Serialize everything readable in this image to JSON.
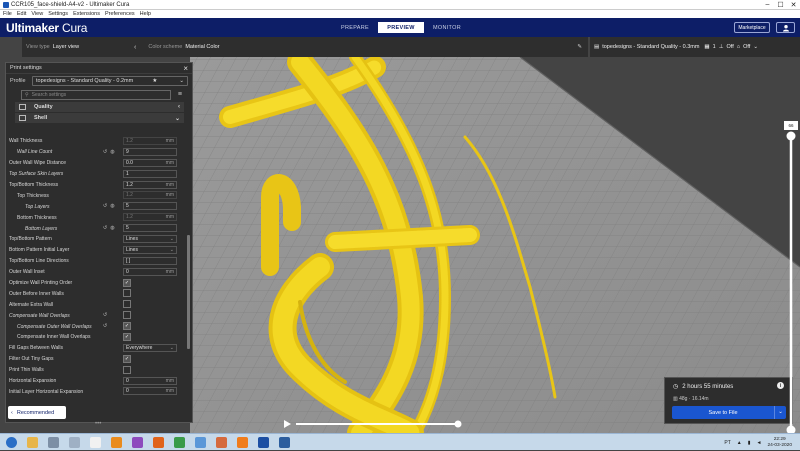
{
  "window": {
    "title": "CCR105_face-shield-A4-v2 - Ultimaker Cura",
    "controls": [
      "–",
      "☐",
      "✕"
    ]
  },
  "menu": [
    "File",
    "Edit",
    "View",
    "Settings",
    "Extensions",
    "Preferences",
    "Help"
  ],
  "header": {
    "logo_bold": "Ultimaker",
    "logo_light": " Cura",
    "stages": [
      {
        "label": "PREPARE",
        "active": false
      },
      {
        "label": "PREVIEW",
        "active": true
      },
      {
        "label": "MONITOR",
        "active": false
      }
    ],
    "marketplace_label": "Marketplace",
    "account_icon": "account-icon"
  },
  "view_bar": {
    "view_type_label": "View type",
    "view_type_value": "Layer view",
    "color_scheme_label": "Color scheme",
    "color_scheme_value": "Material Color",
    "chevron": "‹"
  },
  "print_bar": {
    "profile_text": "topedesigns - Standard Quality - 0.3mm",
    "percent": "1",
    "support_label": "Off",
    "adhesion_label": "Off"
  },
  "print_settings": {
    "title": "Print settings",
    "close": "×",
    "profile_label": "Profile",
    "profile_value": "topedesigns - Standard Quality - 0.2mm",
    "star": "★",
    "profile_chevron": "⌄",
    "search_placeholder": "Search settings",
    "menu_icon": "≡",
    "categories": [
      {
        "label": "Quality",
        "chevron": "‹"
      },
      {
        "label": "Shell",
        "chevron": "⌄"
      }
    ],
    "rows": [
      {
        "label": "Wall Thickness",
        "indent": 0,
        "italic": false,
        "type": "value",
        "value": "1.2",
        "unit": "mm",
        "disabled": true,
        "reset": false,
        "linked": false
      },
      {
        "label": "Wall Line Count",
        "indent": 1,
        "italic": true,
        "type": "value",
        "value": "9",
        "unit": "",
        "disabled": false,
        "reset": true,
        "linked": true
      },
      {
        "label": "Outer Wall Wipe Distance",
        "indent": 0,
        "italic": false,
        "type": "value",
        "value": "0.0",
        "unit": "mm",
        "disabled": false,
        "reset": false,
        "linked": false
      },
      {
        "label": "Top Surface Skin Layers",
        "indent": 0,
        "italic": true,
        "type": "value",
        "value": "1",
        "unit": "",
        "disabled": false,
        "reset": false,
        "linked": false
      },
      {
        "label": "Top/Bottom Thickness",
        "indent": 0,
        "italic": false,
        "type": "value",
        "value": "1.2",
        "unit": "mm",
        "disabled": false,
        "reset": false,
        "linked": false
      },
      {
        "label": "Top Thickness",
        "indent": 1,
        "italic": false,
        "type": "value",
        "value": "1.2",
        "unit": "mm",
        "disabled": true,
        "reset": false,
        "linked": false
      },
      {
        "label": "Top Layers",
        "indent": 2,
        "italic": true,
        "type": "value",
        "value": "5",
        "unit": "",
        "disabled": false,
        "reset": true,
        "linked": true
      },
      {
        "label": "Bottom Thickness",
        "indent": 1,
        "italic": false,
        "type": "value",
        "value": "1.2",
        "unit": "mm",
        "disabled": true,
        "reset": false,
        "linked": false
      },
      {
        "label": "Bottom Layers",
        "indent": 2,
        "italic": true,
        "type": "value",
        "value": "5",
        "unit": "",
        "disabled": false,
        "reset": true,
        "linked": true
      },
      {
        "label": "Top/Bottom Pattern",
        "indent": 0,
        "italic": false,
        "type": "select",
        "value": "Lines",
        "unit": "",
        "disabled": false,
        "reset": false,
        "linked": false
      },
      {
        "label": "Bottom Pattern Initial Layer",
        "indent": 0,
        "italic": false,
        "type": "select",
        "value": "Lines",
        "unit": "",
        "disabled": false,
        "reset": false,
        "linked": false
      },
      {
        "label": "Top/Bottom Line Directions",
        "indent": 0,
        "italic": false,
        "type": "value",
        "value": "[ ]",
        "unit": "",
        "disabled": false,
        "reset": false,
        "linked": false
      },
      {
        "label": "Outer Wall Inset",
        "indent": 0,
        "italic": false,
        "type": "value",
        "value": "0",
        "unit": "mm",
        "disabled": false,
        "reset": false,
        "linked": false
      },
      {
        "label": "Optimize Wall Printing Order",
        "indent": 0,
        "italic": false,
        "type": "check",
        "checked": true,
        "reset": false,
        "linked": false
      },
      {
        "label": "Outer Before Inner Walls",
        "indent": 0,
        "italic": false,
        "type": "check",
        "checked": false,
        "reset": false,
        "linked": false
      },
      {
        "label": "Alternate Extra Wall",
        "indent": 0,
        "italic": false,
        "type": "check",
        "checked": false,
        "reset": false,
        "linked": false
      },
      {
        "label": "Compensate Wall Overlaps",
        "indent": 0,
        "italic": true,
        "type": "check",
        "checked": false,
        "reset": true,
        "linked": false
      },
      {
        "label": "Compensate Outer Wall Overlaps",
        "indent": 1,
        "italic": true,
        "type": "check",
        "checked": true,
        "reset": true,
        "linked": false
      },
      {
        "label": "Compensate Inner Wall Overlaps",
        "indent": 1,
        "italic": false,
        "type": "check",
        "checked": true,
        "reset": false,
        "linked": false
      },
      {
        "label": "Fill Gaps Between Walls",
        "indent": 0,
        "italic": false,
        "type": "select",
        "value": "Everywhere",
        "unit": "",
        "disabled": false,
        "reset": false,
        "linked": false
      },
      {
        "label": "Filter Out Tiny Gaps",
        "indent": 0,
        "italic": false,
        "type": "check",
        "checked": true,
        "reset": false,
        "linked": false
      },
      {
        "label": "Print Thin Walls",
        "indent": 0,
        "italic": false,
        "type": "check",
        "checked": false,
        "reset": false,
        "linked": false
      },
      {
        "label": "Horizontal Expansion",
        "indent": 0,
        "italic": false,
        "type": "value",
        "value": "0",
        "unit": "mm",
        "disabled": false,
        "reset": false,
        "linked": false
      },
      {
        "label": "Initial Layer Horizontal Expansion",
        "indent": 0,
        "italic": false,
        "type": "value",
        "value": "0",
        "unit": "mm",
        "disabled": false,
        "reset": false,
        "linked": false
      }
    ],
    "recommended_label": "Recommended",
    "recommended_chevron": "‹",
    "more_dots": "•••"
  },
  "output": {
    "time": "2 hours 55 minutes",
    "material": "48g · 16.14m",
    "save_label": "Save to File",
    "save_chevron": "⌄",
    "info": "i"
  },
  "layer_slider": {
    "current": "66",
    "progress": 1.0
  },
  "simulation": {
    "play_icon": "play-icon",
    "progress": 1.0
  },
  "taskbar": {
    "apps": [
      {
        "name": "start-button",
        "color": "#2a6ec6"
      },
      {
        "name": "explorer-icon",
        "color": "#e7b54a"
      },
      {
        "name": "maximized-window-icon",
        "color": "#7d8fa5"
      },
      {
        "name": "window-icon",
        "color": "#9fb0c4"
      },
      {
        "name": "document-icon",
        "color": "#f1f1f1"
      },
      {
        "name": "vlc-icon",
        "color": "#e98b1d"
      },
      {
        "name": "visual-studio-icon",
        "color": "#8d4bbd"
      },
      {
        "name": "firefox-icon",
        "color": "#e0631b"
      },
      {
        "name": "chrome-icon",
        "color": "#3a9b4a"
      },
      {
        "name": "paint-icon",
        "color": "#5a97d8"
      },
      {
        "name": "images-icon",
        "color": "#d56a3e"
      },
      {
        "name": "fusion-icon",
        "color": "#f07c1b"
      },
      {
        "name": "cura-icon",
        "color": "#1c4fa3"
      },
      {
        "name": "photoshop-icon",
        "color": "#2b5d9e"
      }
    ],
    "language": "PT",
    "time": "22:29",
    "date": "24-03-2020"
  },
  "colors": {
    "header": "#0d1e67",
    "accent_blue": "#1a56d0",
    "filament": "#f1d21c",
    "panel": "#2d2d2d"
  }
}
